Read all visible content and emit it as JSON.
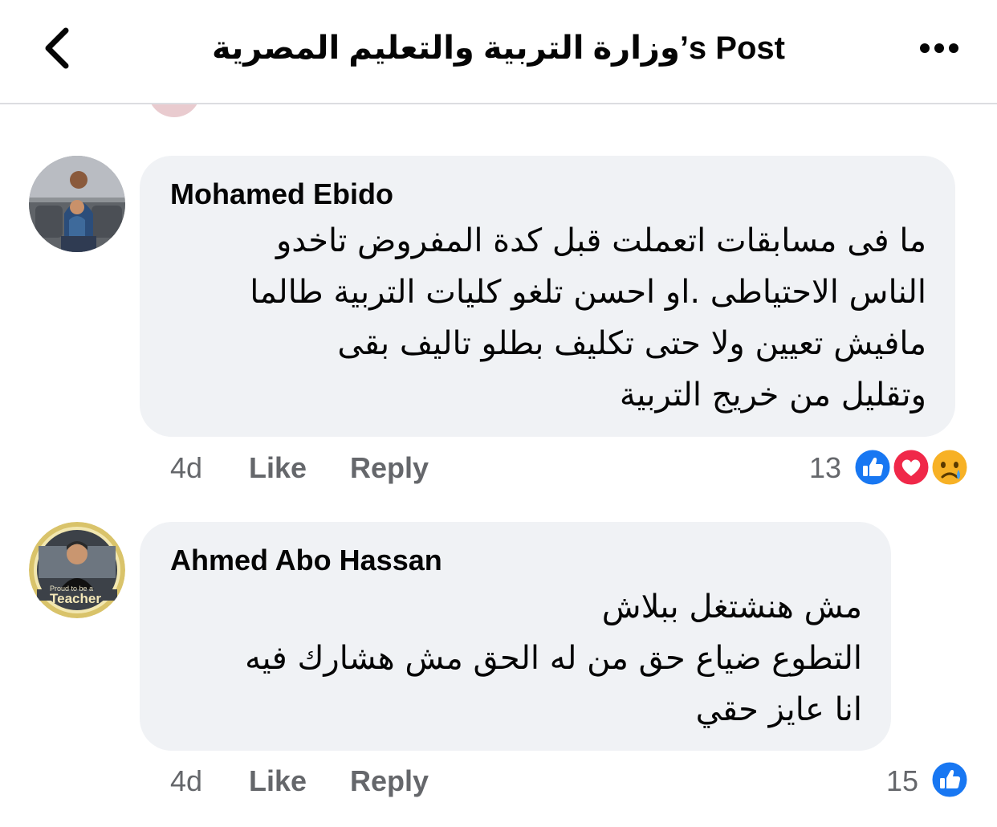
{
  "header": {
    "title": "وزارة التربية والتعليم المصرية’s Post",
    "back_icon": "chevron-left-icon",
    "more_icon": "more-horizontal-icon"
  },
  "comments": [
    {
      "author": "Mohamed Ebido",
      "lines": [
        "ما فى مسابقات اتعملت قبل كدة المفروض تاخدو",
        "الناس الاحتياطى .او احسن تلغو كليات التربية طالما",
        "مافيش تعيين ولا حتى تكليف بطلو تاليف بقى",
        "وتقليل من خريج التربية"
      ],
      "time": "4d",
      "like_label": "Like",
      "reply_label": "Reply",
      "reaction_count": "13",
      "reactions": [
        "like-reaction-icon",
        "love-reaction-icon",
        "sad-reaction-icon"
      ]
    },
    {
      "author": "Ahmed Abo Hassan",
      "avatar_text": "Proud to be a",
      "avatar_text_big": "Teacher",
      "lines": [
        "مش هنشتغل ببلاش",
        "التطوع ضياع حق من له الحق مش هشارك فيه",
        "انا عايز حقي"
      ],
      "time": "4d",
      "like_label": "Like",
      "reply_label": "Reply",
      "reaction_count": "15",
      "reactions": [
        "like-reaction-icon"
      ]
    }
  ],
  "colors": {
    "bubble": "#f0f2f5",
    "meta_text": "#65676b",
    "like_blue": "#1877f2",
    "love_red": "#f02849",
    "sad_yellow": "#f7b125"
  }
}
